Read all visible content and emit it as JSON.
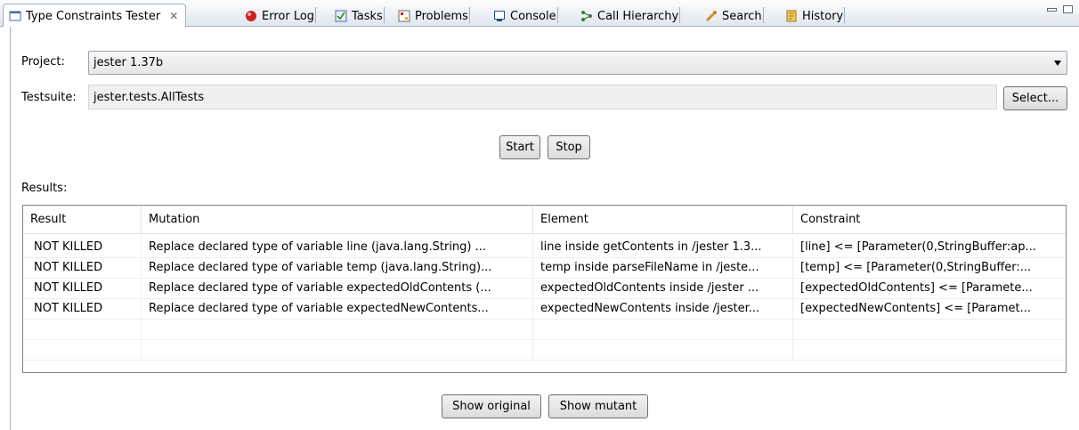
{
  "tabs": [
    {
      "label": "Type Constraints Tester",
      "icon": "window-icon",
      "active": true
    },
    {
      "label": "Error Log",
      "icon": "error-log-icon"
    },
    {
      "label": "Tasks",
      "icon": "tasks-icon"
    },
    {
      "label": "Problems",
      "icon": "problems-icon"
    },
    {
      "label": "Console",
      "icon": "console-icon"
    },
    {
      "label": "Call Hierarchy",
      "icon": "call-hierarchy-icon"
    },
    {
      "label": "Search",
      "icon": "search-icon"
    },
    {
      "label": "History",
      "icon": "history-icon"
    }
  ],
  "form": {
    "project_label": "Project:",
    "project_value": "jester 1.37b",
    "testsuite_label": "Testsuite:",
    "testsuite_value": "jester.tests.AllTests",
    "select_button": "Select...",
    "start_button": "Start",
    "stop_button": "Stop",
    "results_label": "Results:"
  },
  "table": {
    "columns": [
      "Result",
      "Mutation",
      "Element",
      "Constraint"
    ],
    "rows": [
      [
        "NOT KILLED",
        "Replace declared type of variable line (java.lang.String) ...",
        "line inside getContents in /jester 1.3...",
        "[line] <= [Parameter(0,StringBuffer:ap..."
      ],
      [
        "NOT KILLED",
        "Replace declared type of variable temp (java.lang.String)...",
        "temp inside parseFileName in /jeste...",
        "[temp] <= [Parameter(0,StringBuffer:..."
      ],
      [
        "NOT KILLED",
        "Replace declared type of variable expectedOldContents (...",
        "expectedOldContents inside /jester ...",
        "[expectedOldContents] <= [Paramete..."
      ],
      [
        "NOT KILLED",
        "Replace declared type of variable expectedNewContents...",
        "expectedNewContents inside /jester...",
        "[expectedNewContents] <= [Paramet..."
      ]
    ]
  },
  "buttons": {
    "show_original": "Show original",
    "show_mutant": "Show mutant"
  },
  "colors": {
    "accent_border": "#9fb0c6",
    "error_icon": "#cc2222"
  }
}
